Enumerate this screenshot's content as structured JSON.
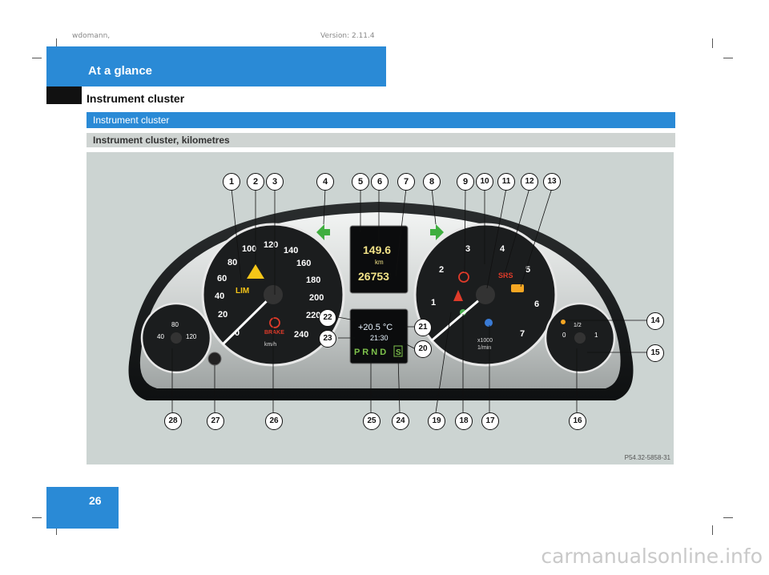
{
  "header": {
    "meta_left": "wdomann,",
    "meta_right": "Version: 2.11.4",
    "section": "At a glance",
    "title": "Instrument cluster"
  },
  "headings": {
    "main": "Instrument cluster",
    "sub": "Instrument cluster, kilometres"
  },
  "figure": {
    "id": "P54.32-5858-31",
    "callouts_top": [
      "1",
      "2",
      "3",
      "4",
      "5",
      "6",
      "7",
      "8",
      "9",
      "10",
      "11",
      "12",
      "13"
    ],
    "callouts_right": [
      "14",
      "15"
    ],
    "callouts_bottom": [
      "28",
      "27",
      "26",
      "25",
      "24",
      "19",
      "18",
      "17",
      "16"
    ],
    "callouts_center": [
      "22",
      "23",
      "21",
      "20"
    ],
    "speedo_ticks": [
      "0",
      "20",
      "40",
      "60",
      "80",
      "100",
      "120",
      "140",
      "160",
      "180",
      "200",
      "220",
      "240"
    ],
    "speedo_unit": "km/h",
    "lim": "LIM",
    "brake": "BRAKE",
    "display_speed": "149.6",
    "display_km": "km",
    "odometer": "26753",
    "temp_outside": "+20.5 °C",
    "clock": "21:30",
    "gears": "P R N D",
    "gear_s": "S",
    "tacho_ticks": [
      "1",
      "2",
      "3",
      "4",
      "5",
      "6",
      "7"
    ],
    "tacho_unit1": "x1000",
    "tacho_unit2": "1/min",
    "srs": "SRS",
    "coolant_ticks": [
      "40",
      "80",
      "120"
    ],
    "fuel_ticks": [
      "0",
      "1/2",
      "1"
    ]
  },
  "footer": {
    "page_number": "26",
    "watermark": "carmanualsonline.info"
  }
}
